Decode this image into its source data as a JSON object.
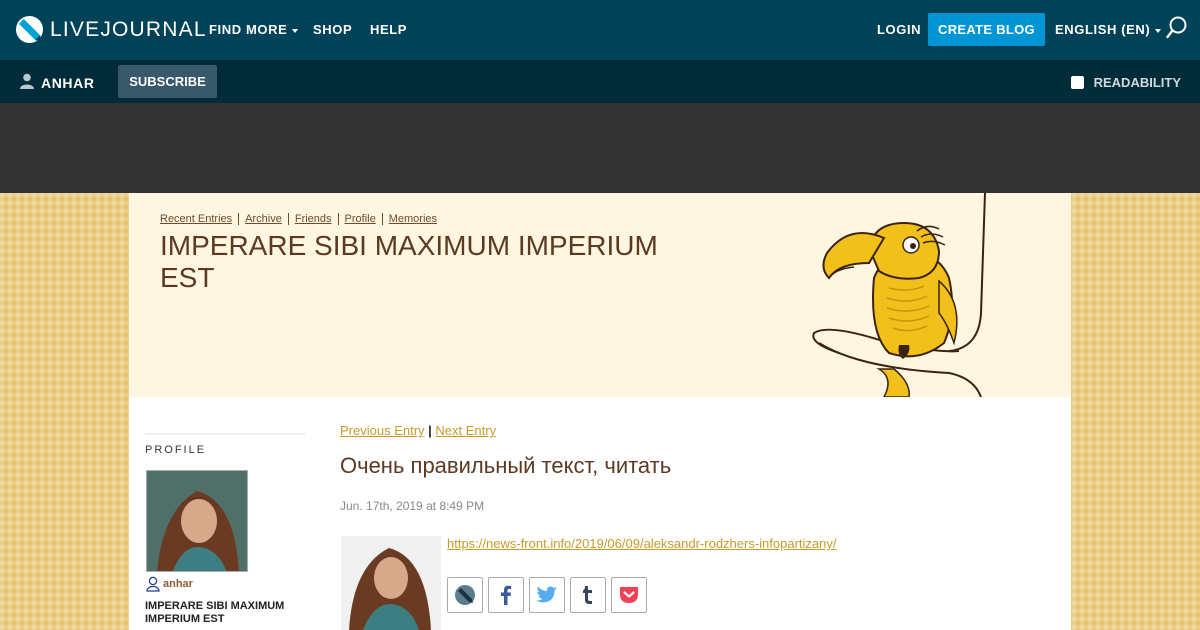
{
  "topnav": {
    "logo_text": "LIVEJOURNAL",
    "find_more": "FIND MORE",
    "shop": "SHOP",
    "help": "HELP",
    "login": "LOGIN",
    "create_blog": "CREATE BLOG",
    "language": "ENGLISH (EN)"
  },
  "userbar": {
    "username": "ANHAR",
    "subscribe": "SUBSCRIBE",
    "readability": "READABILITY"
  },
  "header": {
    "crumbs": [
      "Recent Entries",
      "Archive",
      "Friends",
      "Profile",
      "Memories"
    ],
    "title": "IMPERARE SIBI MAXIMUM IMPERIUM EST"
  },
  "sidebar": {
    "heading": "PROFILE",
    "user": "anhar",
    "journal_title": "IMPERARE SIBI MAXIMUM IMPERIUM EST"
  },
  "entry": {
    "prev": "Previous Entry",
    "sep": " | ",
    "next": "Next Entry",
    "title": "Очень правильный текст, читать",
    "date": "Jun. 17th, 2019 at 8:49 PM",
    "link": "https://news-front.info/2019/06/09/aleksandr-rodzhers-infopartizany/"
  },
  "icons": {
    "logo": "livejournal-logo-icon",
    "search": "search-icon",
    "user": "user-icon",
    "share_lj": "livejournal-share-icon",
    "share_fb": "facebook-icon",
    "share_tw": "twitter-icon",
    "share_tumblr": "tumblr-icon",
    "share_pocket": "pocket-icon"
  },
  "colors": {
    "topbar": "#004359",
    "userbar": "#002b39",
    "accent_button": "#0095d3",
    "link": "#c69b2a",
    "title": "#5c3a22"
  }
}
